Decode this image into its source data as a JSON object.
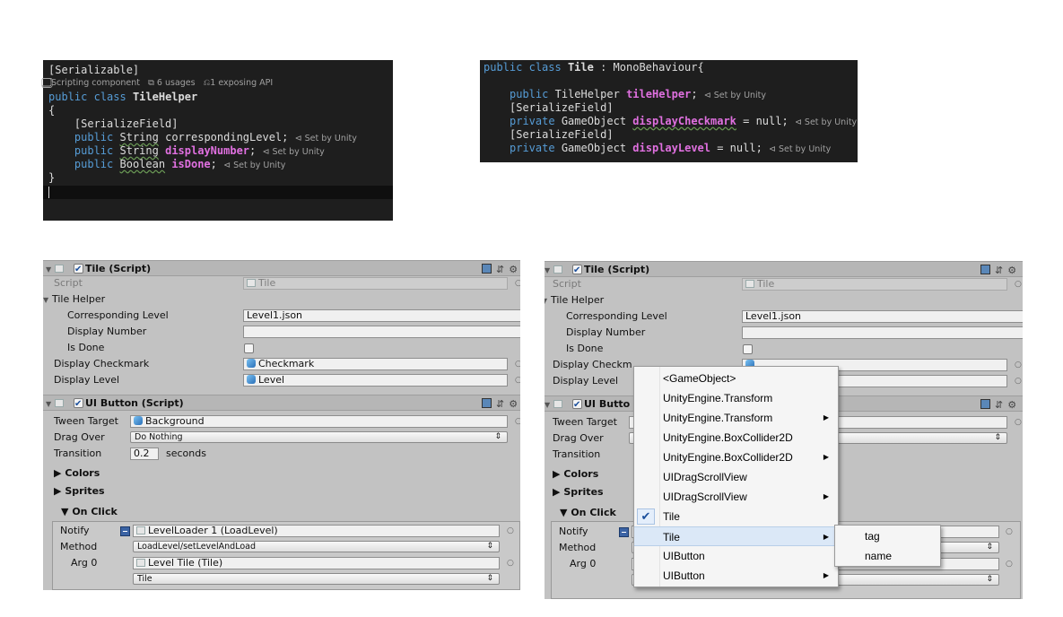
{
  "code_left": {
    "attr_serializable": "[Serializable]",
    "lens_scripting": "⃣ Scripting component",
    "lens_usages": "6 usages",
    "lens_api": "1 exposing API",
    "kw_public": "public",
    "kw_class": "class",
    "class_name": "TileHelper",
    "brace_open": "{",
    "attr_serializefield": "[SerializeField]",
    "type_string": "String",
    "type_boolean": "Boolean",
    "field_corresponding": "correspondingLevel",
    "field_display_number": "displayNumber",
    "field_is_done": "isDone",
    "semicolon": ";",
    "set_by_unity": "Set by Unity",
    "brace_close": "}"
  },
  "code_right": {
    "kw_public": "public",
    "kw_class": "class",
    "class_name": "Tile",
    "base": ": MonoBehaviour{",
    "type_tilehelper": "TileHelper",
    "field_tilehelper": "tileHelper",
    "attr_serializefield": "[SerializeField]",
    "kw_private": "private",
    "type_gameobject": "GameObject",
    "field_checkmark": "displayCheckmark",
    "field_level": "displayLevel",
    "assign_null": "= null;",
    "semicolon": ";",
    "set_by_unity": "Set by Unity"
  },
  "inspector": {
    "tile_script_title": "Tile (Script)",
    "script_label": "Script",
    "script_value": "Tile",
    "tile_helper_label": "Tile Helper",
    "corresponding_level_label": "Corresponding Level",
    "corresponding_level_value": "Level1.json",
    "display_number_label": "Display Number",
    "display_number_value": "",
    "is_done_label": "Is Done",
    "display_checkmark_label": "Display Checkmark",
    "display_checkmark_value": "Checkmark",
    "display_level_label": "Display Level",
    "display_level_value": "Level",
    "ui_button_title": "UI Button (Script)",
    "ui_button_title_short": "UI Butto",
    "tween_target_label": "Tween Target",
    "tween_target_value": "Background",
    "drag_over_label": "Drag Over",
    "drag_over_value": "Do Nothing",
    "transition_label": "Transition",
    "transition_value": "0.2",
    "transition_unit": "seconds",
    "colors_label": "Colors",
    "sprites_label": "Sprites",
    "on_click_label": "On Click",
    "notify_label": "Notify",
    "notify_value": "LevelLoader 1 (LoadLevel)",
    "method_label": "Method",
    "method_value": "LoadLevel/setLevelAndLoad",
    "arg0_label": "Arg 0",
    "arg0_value": "Level Tile (Tile)",
    "arg0_dropdown": "Tile",
    "display_checkmark_label_clipped": "Display Checkm"
  },
  "context_menu": {
    "items": [
      {
        "label": "<GameObject>"
      },
      {
        "label": "UnityEngine.Transform"
      },
      {
        "label": "UnityEngine.Transform",
        "submenu": true
      },
      {
        "label": "UnityEngine.BoxCollider2D"
      },
      {
        "label": "UnityEngine.BoxCollider2D",
        "submenu": true
      },
      {
        "label": "UIDragScrollView"
      },
      {
        "label": "UIDragScrollView",
        "submenu": true
      },
      {
        "label": "Tile",
        "checked": true
      },
      {
        "label": "Tile",
        "submenu": true,
        "highlighted": true
      },
      {
        "label": "UIButton"
      },
      {
        "label": "UIButton",
        "submenu": true
      }
    ],
    "submenu_items": [
      "tag",
      "name"
    ]
  },
  "colors": {
    "code_bg": "#1e1e1e",
    "keyword": "#569cd6",
    "type": "#4ec9b0",
    "field": "#e070e0",
    "inspector_bg": "#c2c2c2",
    "menu_highlight": "#dbe8f7"
  }
}
